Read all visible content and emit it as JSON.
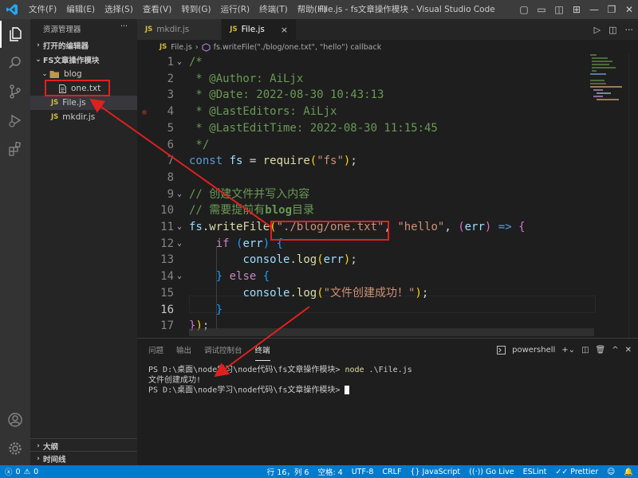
{
  "titlebar": {
    "menu": [
      "文件(F)",
      "编辑(E)",
      "选择(S)",
      "查看(V)",
      "转到(G)",
      "运行(R)",
      "终端(T)",
      "帮助(H)"
    ],
    "title": "File.js - fs文章操作模块 - Visual Studio Code"
  },
  "sidebar": {
    "header": "资源管理器",
    "more": "···",
    "open_editors": "打开的编辑器",
    "project": "FS文章操作模块",
    "folder": "blog",
    "files": [
      {
        "badge": "",
        "name": "one.txt"
      },
      {
        "badge": "JS",
        "name": "File.js"
      },
      {
        "badge": "JS",
        "name": "mkdir.js"
      }
    ],
    "outline": "大纲",
    "timeline": "时间线"
  },
  "tabs": [
    {
      "badge": "JS",
      "name": "mkdir.js"
    },
    {
      "badge": "JS",
      "name": "File.js",
      "close": "×"
    }
  ],
  "breadcrumb": {
    "file": "File.js",
    "sep": "›",
    "symbol": "fs.writeFile(\"./blog/one.txt\", \"hello\") callback"
  },
  "editor": {
    "line_numbers": [
      "1",
      "2",
      "3",
      "4",
      "5",
      "6",
      "7",
      "8",
      "9",
      "10",
      "11",
      "12",
      "13",
      "14",
      "15",
      "16",
      "17"
    ],
    "current_line": 16,
    "lines": {
      "l1": "/*",
      "l2": " * @Author: AiLjx",
      "l3": " * @Date: 2022-08-30 10:43:13",
      "l4": " * @LastEditors: AiLjx",
      "l5": " * @LastEditTime: 2022-08-30 11:15:45",
      "l6": " */",
      "l7": {
        "kw": "const",
        "var": "fs",
        "eq": " = ",
        "fn": "require",
        "str": "\"fs\"",
        "end": ";"
      },
      "l9": "// 创建文件并写入内容",
      "l10a": "// 需要提前有",
      "l10b": "blog",
      "l10c": "目录",
      "l11": {
        "obj": "fs",
        "dot": ".",
        "fn": "writeFile",
        "p1": "\"./blog/one.txt\"",
        "comma": ", ",
        "p2": "\"hello\"",
        "arg": "err",
        "arrow": " => "
      },
      "l12": {
        "kw": "if",
        "var": "err"
      },
      "l13": {
        "obj": "console",
        "fn": "log",
        "arg": "err"
      },
      "l14": {
        "kw": "else"
      },
      "l15": {
        "obj": "console",
        "fn": "log",
        "str": "\"文件创建成功！\""
      },
      "l17": "});"
    }
  },
  "panel": {
    "tabs": [
      "问题",
      "输出",
      "调试控制台",
      "终端"
    ],
    "active_tab": "终端",
    "shell": "powershell",
    "terminal": [
      {
        "prompt": "PS D:\\桌面\\node学习\\node代码\\fs文章操作模块> ",
        "cmd": "node",
        "rest": " .\\File.js"
      },
      {
        "text": "文件创建成功!"
      },
      {
        "prompt": "PS D:\\桌面\\node学习\\node代码\\fs文章操作模块> "
      }
    ]
  },
  "statusbar": {
    "errors": "0",
    "warnings": "0",
    "position": "行 16，列 6",
    "spaces": "空格: 4",
    "encoding": "UTF-8",
    "eol": "CRLF",
    "language": "{} JavaScript",
    "golive": "Go Live",
    "eslint": "ESLint",
    "prettier": "Prettier"
  },
  "colors": {
    "accent": "#007acc",
    "annotation": "#e02020"
  }
}
